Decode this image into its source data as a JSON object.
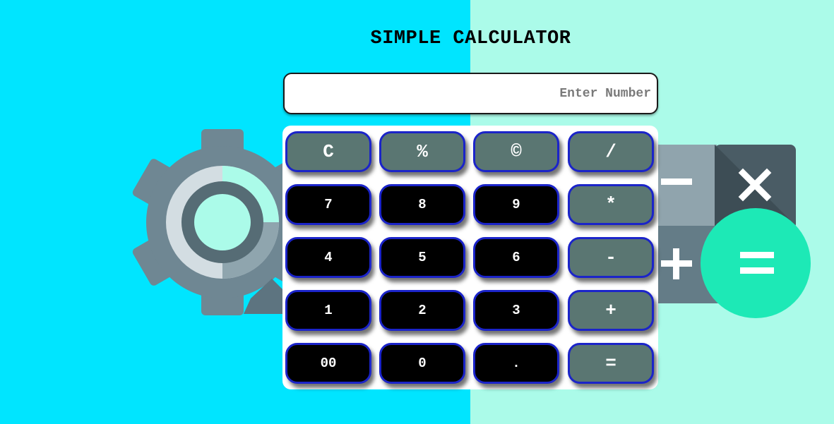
{
  "header": {
    "title": "SIMPLE CALCULATOR"
  },
  "display": {
    "value": "",
    "placeholder": "Enter Number"
  },
  "colors": {
    "left_background": "#00e5ff",
    "right_background": "#abfbe9",
    "operator_key": "#5a7672",
    "number_key": "#000000",
    "key_border": "#1b24c9"
  },
  "decor": {
    "left_icon": "settings-gear-icon",
    "right_icon": "calculator-app-icon"
  },
  "keypad": {
    "rows": [
      [
        {
          "label": "C",
          "kind": "op",
          "name": "clear-button"
        },
        {
          "label": "%",
          "kind": "op",
          "name": "percent-button"
        },
        {
          "label": "©",
          "kind": "op",
          "name": "copyright-button"
        },
        {
          "label": "/",
          "kind": "op",
          "name": "divide-button"
        }
      ],
      [
        {
          "label": "7",
          "kind": "num",
          "name": "digit-7-button"
        },
        {
          "label": "8",
          "kind": "num",
          "name": "digit-8-button"
        },
        {
          "label": "9",
          "kind": "num",
          "name": "digit-9-button"
        },
        {
          "label": "*",
          "kind": "op",
          "name": "multiply-button"
        }
      ],
      [
        {
          "label": "4",
          "kind": "num",
          "name": "digit-4-button"
        },
        {
          "label": "5",
          "kind": "num",
          "name": "digit-5-button"
        },
        {
          "label": "6",
          "kind": "num",
          "name": "digit-6-button"
        },
        {
          "label": "-",
          "kind": "op",
          "name": "subtract-button"
        }
      ],
      [
        {
          "label": "1",
          "kind": "num",
          "name": "digit-1-button"
        },
        {
          "label": "2",
          "kind": "num",
          "name": "digit-2-button"
        },
        {
          "label": "3",
          "kind": "num",
          "name": "digit-3-button"
        },
        {
          "label": "+",
          "kind": "op",
          "name": "add-button"
        }
      ],
      [
        {
          "label": "00",
          "kind": "num",
          "name": "double-zero-button"
        },
        {
          "label": "0",
          "kind": "num",
          "name": "digit-0-button"
        },
        {
          "label": ".",
          "kind": "num",
          "name": "decimal-point-button"
        },
        {
          "label": "=",
          "kind": "op",
          "name": "equals-button"
        }
      ]
    ]
  }
}
